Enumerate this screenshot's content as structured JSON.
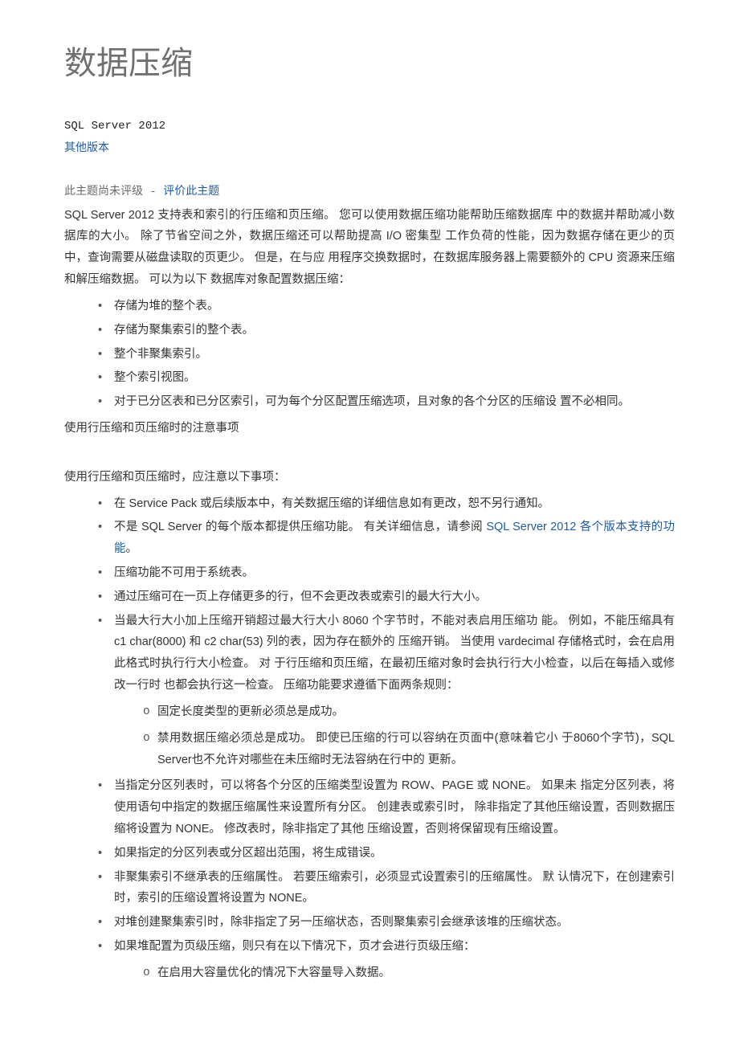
{
  "title": "数据压缩",
  "version_line": "SQL Server 2012",
  "other_versions_link": "其他版本",
  "rating_prefix": "此主题尚未评级 ",
  "rating_sep": "- ",
  "rating_link": "评价此主题",
  "intro_p1": "SQL Server 2012 支持表和索引的行压缩和页压缩。 您可以使用数据压缩功能帮助压缩数据库 中的数据并帮助减小数据库的大小。 除了节省空间之外，数据压缩还可以帮助提高 I/O 密集型 工作负荷的性能，因为数据存储在更少的页中，查询需要从磁盘读取的页更少。 但是，在与应 用程序交换数据时，在数据库服务器上需要额外的 CPU 资源来压缩和解压缩数据。 可以为以下 数据库对象配置数据压缩：",
  "list1": [
    "存储为堆的整个表。",
    "存储为聚集索引的整个表。",
    "整个非聚集索引。",
    "整个索引视图。",
    "对于已分区表和已分区索引，可为每个分区配置压缩选项，且对象的各个分区的压缩设 置不必相同。"
  ],
  "subhead1": "使用行压缩和页压缩时的注意事项",
  "intro_p2": "使用行压缩和页压缩时，应注意以下事项：",
  "list2_li1": "在 Service Pack 或后续版本中，有关数据压缩的详细信息如有更改，恕不另行通知。",
  "list2_li2_a": "不是 SQL Server 的每个版本都提供压缩功能。 有关详细信息，请参阅 ",
  "list2_li2_link": "SQL Server 2012 各个版本支持的功能",
  "list2_li2_b": "。",
  "list2_li3": "压缩功能不可用于系统表。",
  "list2_li4": "通过压缩可在一页上存储更多的行，但不会更改表或索引的最大行大小。",
  "list2_li5": "当最大行大小加上压缩开销超过最大行大小 8060 个字节时，不能对表启用压缩功 能。 例如，不能压缩具有 c1 char(8000) 和 c2 char(53) 列的表，因为存在额外的 压缩开销。 当使用 vardecimal 存储格式时，会在启用此格式时执行行大小检查。 对 于行压缩和页压缩，在最初压缩对象时会执行行大小检查，以后在每插入或修改一行时 也都会执行这一检查。 压缩功能要求遵循下面两条规则：",
  "list2_li5_sub": [
    "固定长度类型的更新必须总是成功。",
    "禁用数据压缩必须总是成功。 即使已压缩的行可以容纳在页面中(意味着它小 于8060个字节)，SQL Server也不允许对哪些在未压缩时无法容纳在行中的 更新。"
  ],
  "list2_li6": "当指定分区列表时，可以将各个分区的压缩类型设置为 ROW、PAGE 或 NONE。 如果未 指定分区列表，将使用语句中指定的数据压缩属性来设置所有分区。 创建表或索引时， 除非指定了其他压缩设置，否则数据压缩将设置为 NONE。 修改表时，除非指定了其他 压缩设置，否则将保留现有压缩设置。",
  "list2_li7": "如果指定的分区列表或分区超出范围，将生成错误。",
  "list2_li8": "非聚集索引不继承表的压缩属性。 若要压缩索引，必须显式设置索引的压缩属性。 默 认情况下，在创建索引时，索引的压缩设置将设置为 NONE。",
  "list2_li9": "对堆创建聚集索引时，除非指定了另一压缩状态，否则聚集索引会继承该堆的压缩状态。",
  "list2_li10": "如果堆配置为页级压缩，则只有在以下情况下，页才会进行页级压缩：",
  "list2_li10_sub": [
    "在启用大容量优化的情况下大容量导入数据。"
  ]
}
